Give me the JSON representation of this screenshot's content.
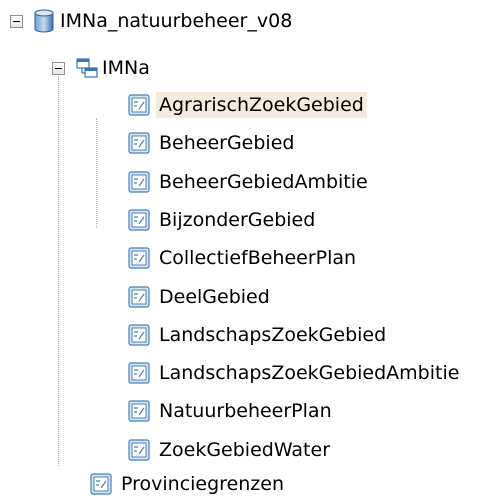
{
  "tree": {
    "database": {
      "label": "IMNa_natuurbeheer_v08",
      "icon": "database-icon",
      "expanded": true
    },
    "schema": {
      "label": "IMNa",
      "icon": "schema-icon",
      "expanded": true
    },
    "feature_classes": [
      {
        "label": "AgrarischZoekGebied",
        "selected": true
      },
      {
        "label": "BeheerGebied"
      },
      {
        "label": "BeheerGebiedAmbitie"
      },
      {
        "label": "BijzonderGebied"
      },
      {
        "label": "CollectiefBeheerPlan"
      },
      {
        "label": "DeelGebied"
      },
      {
        "label": "LandschapsZoekGebied"
      },
      {
        "label": "LandschapsZoekGebiedAmbitie"
      },
      {
        "label": "NatuurbeheerPlan"
      },
      {
        "label": "ZoekGebiedWater"
      }
    ],
    "root_table": {
      "label": "Provinciegrenzen"
    }
  },
  "colors": {
    "selection": "#f3ecde",
    "icon_blue": "#4a7fb5",
    "db_blue": "#3b6fb0"
  }
}
